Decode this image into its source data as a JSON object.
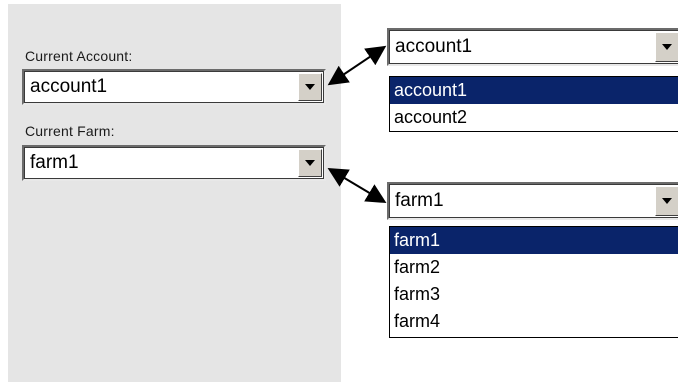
{
  "left_panel": {
    "account_label": "Current Account:",
    "account_value": "account1",
    "farm_label": "Current Farm:",
    "farm_value": "farm1"
  },
  "account_dropdown_expanded": {
    "value": "account1",
    "options": [
      "account1",
      "account2"
    ],
    "selected_index": 0
  },
  "farm_dropdown_expanded": {
    "value": "farm1",
    "options": [
      "farm1",
      "farm2",
      "farm3",
      "farm4"
    ],
    "selected_index": 0
  },
  "icons": {
    "dropdown": "chevron-down-icon",
    "connector": "double-arrow-icon"
  },
  "colors": {
    "panel_bg": "#e5e5e5",
    "selection_bg": "#0a246a",
    "selection_fg": "#ffffff"
  }
}
